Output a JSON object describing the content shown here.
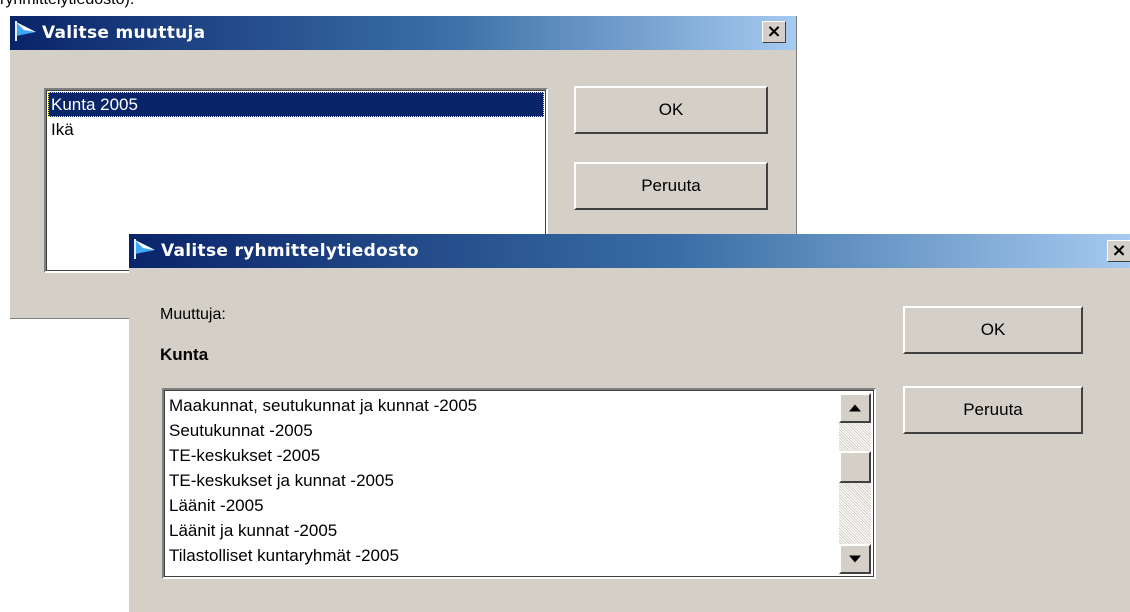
{
  "background_caption": "ryhmittelytiedosto).",
  "dialog1": {
    "title": "Valitse muuttuja",
    "close_label": "×",
    "list": [
      "Kunta 2005",
      "Ikä"
    ],
    "selected_index": 0,
    "ok_label": "OK",
    "cancel_label": "Peruuta"
  },
  "dialog2": {
    "title": "Valitse ryhmittelytiedosto",
    "close_label": "×",
    "variable_label": "Muuttuja:",
    "variable_value": "Kunta",
    "list": [
      "Maakunnat, seutukunnat ja kunnat -2005",
      "Seutukunnat -2005",
      "TE-keskukset -2005",
      "TE-keskukset ja kunnat -2005",
      "Läänit -2005",
      "Läänit ja kunnat -2005",
      "Tilastolliset kuntaryhmät -2005"
    ],
    "ok_label": "OK",
    "cancel_label": "Peruuta"
  },
  "colors": {
    "titlebar_start": "#0a246a",
    "titlebar_end": "#a6caf0",
    "dialog_face": "#d4d0c8",
    "selection": "#0a246a"
  },
  "icons": [
    "window-flag-icon",
    "close-icon",
    "scroll-up-arrow-icon",
    "scroll-down-arrow-icon"
  ]
}
